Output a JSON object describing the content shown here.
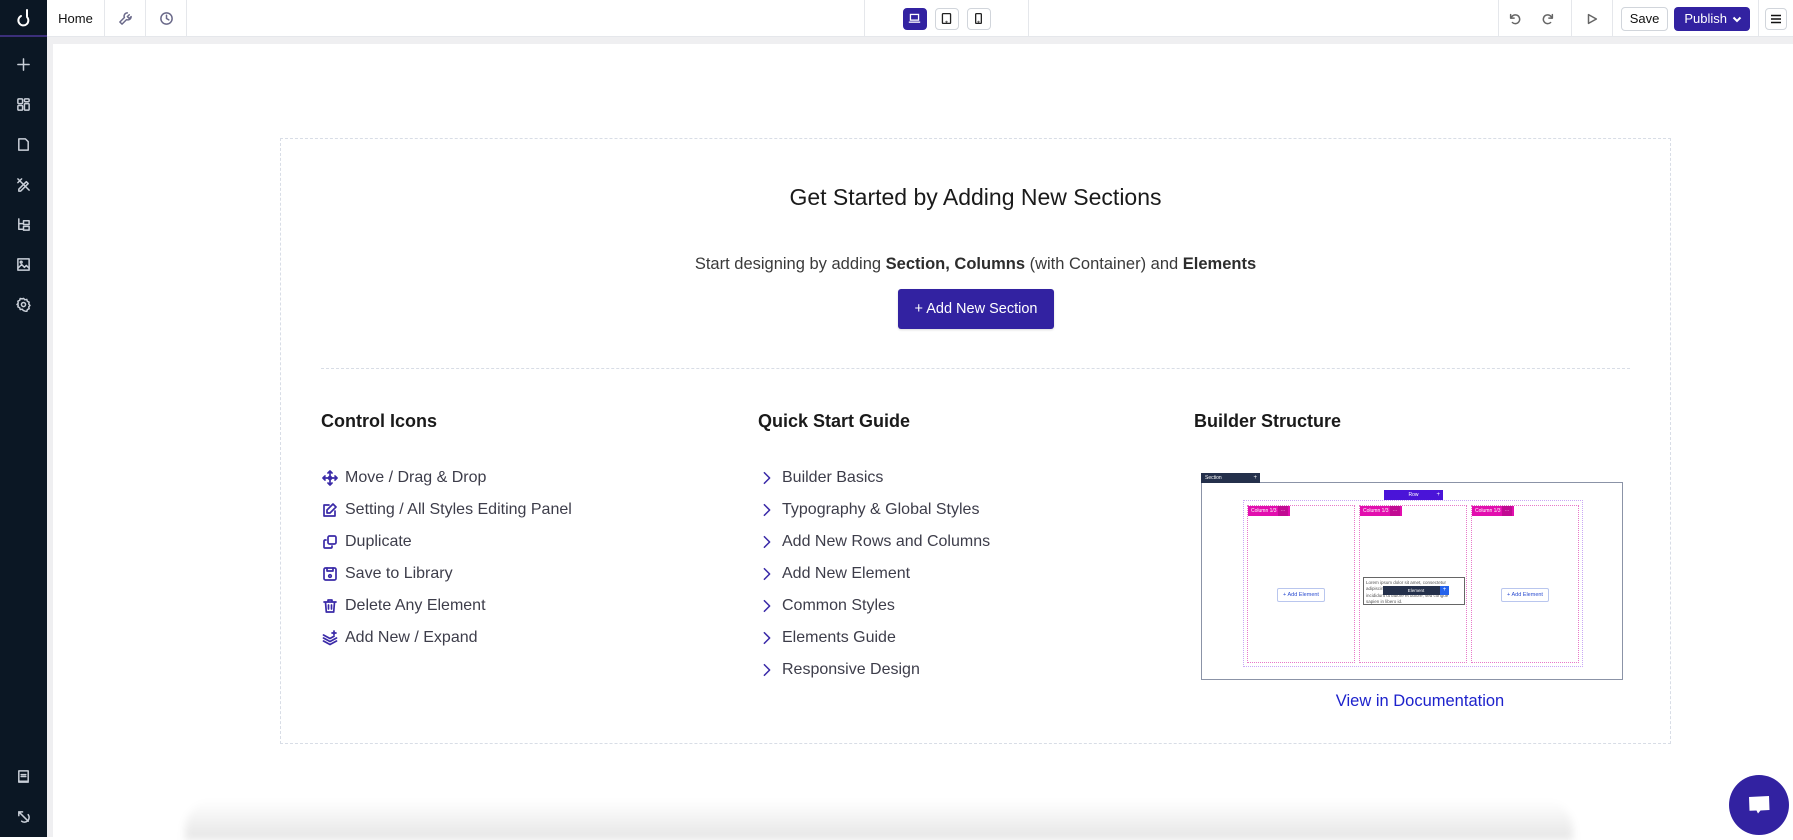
{
  "topbar": {
    "home_tab": "Home",
    "tools_icon": "wrench-icon",
    "history_icon": "clock-icon",
    "devices": [
      {
        "name": "desktop",
        "icon": "laptop-icon",
        "active": true
      },
      {
        "name": "tablet",
        "icon": "tablet-icon",
        "active": false
      },
      {
        "name": "mobile",
        "icon": "mobile-icon",
        "active": false
      }
    ],
    "undo_icon": "undo-icon",
    "redo_icon": "redo-icon",
    "preview_icon": "play-icon",
    "save_label": "Save",
    "publish_label": "Publish",
    "menu_icon": "hamburger-icon"
  },
  "sidebar": {
    "logo": "app-logo",
    "items": [
      {
        "name": "add",
        "icon": "plus-icon"
      },
      {
        "name": "elements",
        "icon": "grid-icon"
      },
      {
        "name": "pages",
        "icon": "page-icon"
      },
      {
        "name": "design",
        "icon": "pen-ruler-icon"
      },
      {
        "name": "navigator",
        "icon": "tree-icon"
      },
      {
        "name": "media",
        "icon": "image-icon"
      },
      {
        "name": "settings",
        "icon": "gear-icon"
      }
    ],
    "bottom_items": [
      {
        "name": "docs",
        "icon": "book-icon"
      },
      {
        "name": "exit",
        "icon": "exit-arrow-icon"
      }
    ]
  },
  "main": {
    "title": "Get Started by Adding New Sections",
    "subtitle_parts": {
      "p1": "Start designing by adding ",
      "b1": "Section, Columns",
      "p2": " (with Container) and ",
      "b2": "Elements"
    },
    "add_section_label": "+ Add New Section",
    "control_icons": {
      "heading": "Control Icons",
      "items": [
        {
          "label": "Move / Drag & Drop",
          "icon": "move-icon"
        },
        {
          "label": "Setting / All Styles Editing Panel",
          "icon": "edit-icon"
        },
        {
          "label": "Duplicate",
          "icon": "duplicate-icon"
        },
        {
          "label": "Save to Library",
          "icon": "save-icon"
        },
        {
          "label": "Delete Any Element",
          "icon": "trash-icon"
        },
        {
          "label": "Add New / Expand",
          "icon": "layers-plus-icon"
        }
      ]
    },
    "quick_start": {
      "heading": "Quick Start Guide",
      "items": [
        "Builder Basics",
        "Typography & Global Styles",
        "Add New Rows and Columns",
        "Add New Element",
        "Common Styles",
        "Elements Guide",
        "Responsive Design"
      ]
    },
    "builder_structure": {
      "heading": "Builder Structure",
      "illustration": {
        "section_tag": "Section",
        "row_tag": "Row",
        "column_tags": [
          "Column 1/3",
          "Column 1/3",
          "Column 1/3"
        ],
        "add_element_label": "+ Add Element",
        "element_tag": "Element",
        "sample_text": "Lorem ipsum dolor sit amet, consectetur adipiscing elit, sed do eiusmod tempor incididunt ut labore et dolore, sed congue sapien in libero id."
      },
      "doc_link": "View in Documentation"
    }
  },
  "chat": {
    "icon": "chat-bubble-icon"
  },
  "colors": {
    "primary": "#3222a1",
    "sidebar_bg": "#0b1724",
    "link": "#1d22cc",
    "column_tag": "#e20eae",
    "row_tag": "#4a14d8"
  }
}
